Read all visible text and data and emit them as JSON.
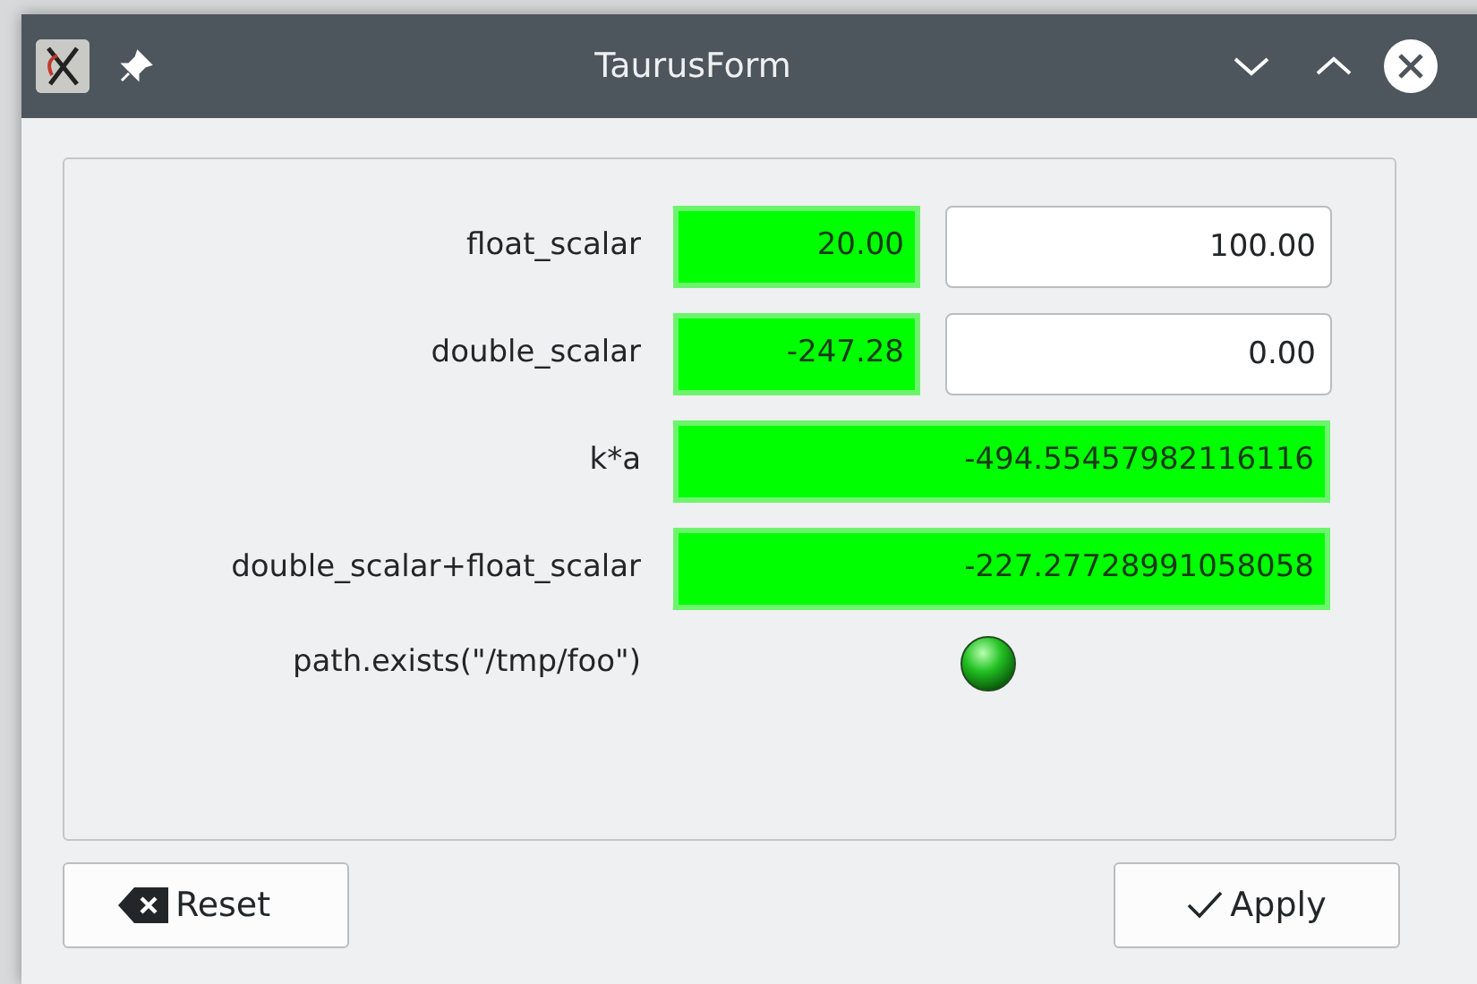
{
  "window": {
    "title": "TaurusForm"
  },
  "rows": [
    {
      "kind": "scalar",
      "label": "float_scalar",
      "value": "20.00",
      "write_value": "100.00"
    },
    {
      "kind": "scalar",
      "label": "double_scalar",
      "value": "-247.28",
      "write_value": "0.00"
    },
    {
      "kind": "expr",
      "label": "k*a",
      "value": "-494.55457982116116"
    },
    {
      "kind": "expr",
      "label": "double_scalar+float_scalar",
      "value": "-227.27728991058058"
    },
    {
      "kind": "led",
      "label": "path.exists(\"/tmp/foo\")",
      "on": true
    }
  ],
  "buttons": [
    {
      "kind": "reset",
      "label": "Reset"
    },
    {
      "kind": "apply",
      "label": "Apply"
    }
  ]
}
